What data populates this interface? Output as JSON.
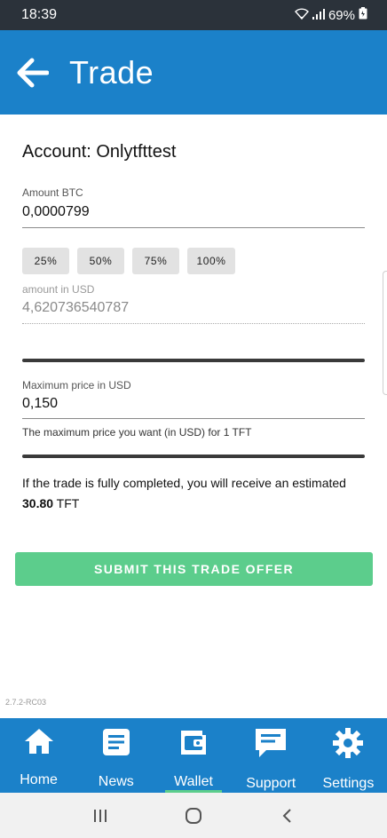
{
  "status": {
    "time": "18:39",
    "battery": "69%"
  },
  "header": {
    "title": "Trade"
  },
  "form": {
    "account": "Account: Onlytfttest",
    "amount_label": "Amount BTC",
    "amount_value": "0,0000799",
    "percent_buttons": [
      "25%",
      "50%",
      "75%",
      "100%"
    ],
    "usd_label": "amount in USD",
    "usd_value": "4,620736540787",
    "max_price_label": "Maximum price in USD",
    "max_price_value": "0,150",
    "max_price_help": "The maximum price you want (in USD) for 1 TFT",
    "estimate_prefix": "If the trade is fully completed, you will receive an estimated ",
    "estimate_amount": "30.80",
    "estimate_suffix": " TFT",
    "submit_label": "SUBMIT THIS TRADE OFFER"
  },
  "version": "2.7.2-RC03",
  "nav": {
    "items": [
      {
        "label": "Home",
        "icon": "home-icon"
      },
      {
        "label": "News",
        "icon": "news-icon"
      },
      {
        "label": "Wallet",
        "icon": "wallet-icon",
        "active": true
      },
      {
        "label": "Support",
        "icon": "chat-icon"
      },
      {
        "label": "Settings",
        "icon": "gear-icon"
      }
    ]
  },
  "colors": {
    "primary": "#1b81c9",
    "accent": "#5ccd8c",
    "statusbar": "#2b323a"
  }
}
